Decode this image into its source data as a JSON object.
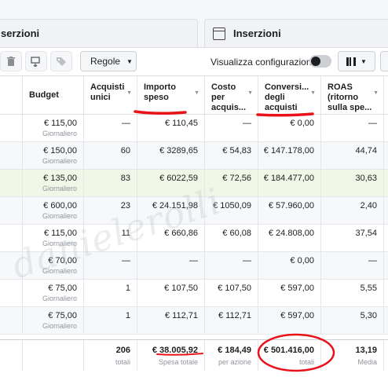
{
  "tabs": {
    "left_label": "serzioni",
    "right_label": "Inserzioni"
  },
  "toolbar": {
    "rules_label": "Regole",
    "config_label": "Visualizza configurazione",
    "icons": [
      "trash-icon",
      "duplicate-icon",
      "tag-icon",
      "columns-icon"
    ]
  },
  "table": {
    "headers": [
      "Budget",
      "Acquisti unici",
      "Importo speso",
      "Costo per acquis...",
      "Conversi... degli acquisti",
      "ROAS (ritorno sulla spe..."
    ],
    "rows": [
      {
        "budget": "€ 115,00",
        "period": "Giornaliero",
        "acq": "—",
        "spent": "€ 110,45",
        "cost": "—",
        "conv": "€ 0,00",
        "roas": "—"
      },
      {
        "budget": "€ 150,00",
        "period": "Giornaliero",
        "acq": "60",
        "spent": "€ 3289,65",
        "cost": "€ 54,83",
        "conv": "€ 147.178,00",
        "roas": "44,74"
      },
      {
        "budget": "€ 135,00",
        "period": "Giornaliero",
        "acq": "83",
        "spent": "€ 6022,59",
        "cost": "€ 72,56",
        "conv": "€ 184.477,00",
        "roas": "30,63"
      },
      {
        "budget": "€ 600,00",
        "period": "Giornaliero",
        "acq": "23",
        "spent": "€ 24.151,98",
        "cost": "€ 1050,09",
        "conv": "€ 57.960,00",
        "roas": "2,40"
      },
      {
        "budget": "€ 115,00",
        "period": "Giornaliero",
        "acq": "11",
        "spent": "€ 660,86",
        "cost": "€ 60,08",
        "conv": "€ 24.808,00",
        "roas": "37,54"
      },
      {
        "budget": "€ 70,00",
        "period": "Giornaliero",
        "acq": "—",
        "spent": "—",
        "cost": "—",
        "conv": "€ 0,00",
        "roas": "—"
      },
      {
        "budget": "€ 75,00",
        "period": "Giornaliero",
        "acq": "1",
        "spent": "€ 107,50",
        "cost": "€ 107,50",
        "conv": "€ 597,00",
        "roas": "5,55"
      },
      {
        "budget": "€ 75,00",
        "period": "Giornaliero",
        "acq": "1",
        "spent": "€ 112,71",
        "cost": "€ 112,71",
        "conv": "€ 597,00",
        "roas": "5,30"
      }
    ],
    "footer": {
      "acq": "206",
      "acq_sub": "totali",
      "spent": "€ 38.005,92",
      "spent_sub": "Spesa totale",
      "cost": "€ 184,49",
      "cost_sub": "per azione",
      "conv": "€ 501.416,00",
      "conv_sub": "totali",
      "roas": "13,19",
      "roas_sub": "Media"
    }
  },
  "watermark": "danielerolli",
  "colors": {
    "annotation_red": "#e8121b",
    "toggle_off": "#ccd0d5",
    "highlight_row": "#f0f7e6"
  }
}
